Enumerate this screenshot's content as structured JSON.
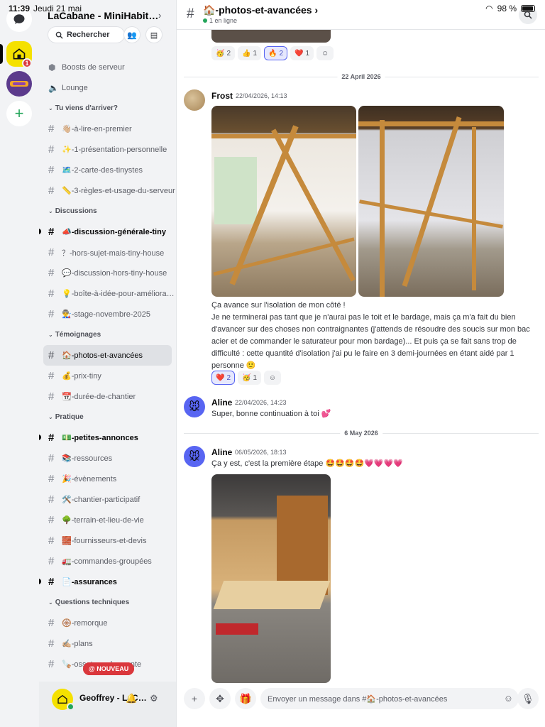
{
  "status": {
    "time": "11:39",
    "date": "Jeudi 21 mai",
    "battery": "98 %"
  },
  "server": {
    "name": "LaCabane - MiniHabitat..."
  },
  "search": {
    "label": "Rechercher"
  },
  "top_items": [
    {
      "label": "Boosts de serveur"
    },
    {
      "label": "Lounge"
    }
  ],
  "categories": [
    {
      "name": "Tu viens d'arriver?",
      "channels": [
        {
          "label": "👋🏼-à-lire-en-premier"
        },
        {
          "label": "✨-1-présentation-personnelle"
        },
        {
          "label": "🗺️-2-carte-des-tinystes"
        },
        {
          "label": "📏-3-règles-et-usage-du-serveur"
        }
      ]
    },
    {
      "name": "Discussions",
      "channels": [
        {
          "label": "📣-discussion-générale-tiny"
        },
        {
          "label": "？-hors-sujet-mais-tiny-house"
        },
        {
          "label": "💬-discussion-hors-tiny-house"
        },
        {
          "label": "💡-boîte-à-idée-pour-amélioration"
        },
        {
          "label": "👨‍🏭-stage-novembre-2025"
        }
      ]
    },
    {
      "name": "Témoignages",
      "channels": [
        {
          "label": "🏠-photos-et-avancées"
        },
        {
          "label": "💰-prix-tiny"
        },
        {
          "label": "📆-durée-de-chantier"
        }
      ]
    },
    {
      "name": "Pratique",
      "channels": [
        {
          "label": "💵-petites-annonces"
        },
        {
          "label": "📚-ressources"
        },
        {
          "label": "🎉-évènements"
        },
        {
          "label": "🛠️-chantier-participatif"
        },
        {
          "label": "🌳-terrain-et-lieu-de-vie"
        },
        {
          "label": "🧱-fournisseurs-et-devis"
        },
        {
          "label": "🚛-commandes-groupées"
        },
        {
          "label": "📄-assurances"
        }
      ]
    },
    {
      "name": "Questions techniques",
      "channels": [
        {
          "label": "🛞-remorque"
        },
        {
          "label": "✍🏼-plans"
        },
        {
          "label": "🪚-ossature-charpente"
        }
      ]
    }
  ],
  "new_badge": "@ NOUVEAU",
  "user": {
    "name": "Geoffrey - LaCabane"
  },
  "channel": {
    "title": "🏠-photos-et-avancées",
    "online": "1 en ligne"
  },
  "reactions_top": [
    {
      "emoji": "🥳",
      "count": "2"
    },
    {
      "emoji": "👍",
      "count": "1"
    },
    {
      "emoji": "🔥",
      "count": "2"
    },
    {
      "emoji": "❤️",
      "count": "1"
    }
  ],
  "divider1": "22 April 2026",
  "msg1": {
    "author": "Frost",
    "time": "22/04/2026, 14:13",
    "text": "Ça avance sur l'isolation de mon côté !\nJe ne terminerai pas tant que je n'aurai pas le toit et le bardage, mais ça m'a fait du bien d'avancer sur des choses non contraignantes (j'attends de résoudre des soucis sur mon bac acier et de commander le saturateur pour mon bardage)... Et puis ça se fait sans trop de difficulté : cette quantité d'isolation j'ai pu le faire en 3 demi-journées en étant aidé par 1 personne 🙂",
    "reactions": [
      {
        "emoji": "❤️",
        "count": "2"
      },
      {
        "emoji": "🥳",
        "count": "1"
      }
    ]
  },
  "msg2": {
    "author": "Aline",
    "time": "22/04/2026, 14:23",
    "text": "Super, bonne continuation à toi 💕"
  },
  "divider2": "6 May 2026",
  "msg3": {
    "author": "Aline",
    "time": "06/05/2026, 18:13",
    "text": "Ça y est, c'est la première étape 🤩🤩🤩🤩💗💗💗💗"
  },
  "composer": {
    "placeholder": "Envoyer un message dans #🏠-photos-et-avancées"
  }
}
